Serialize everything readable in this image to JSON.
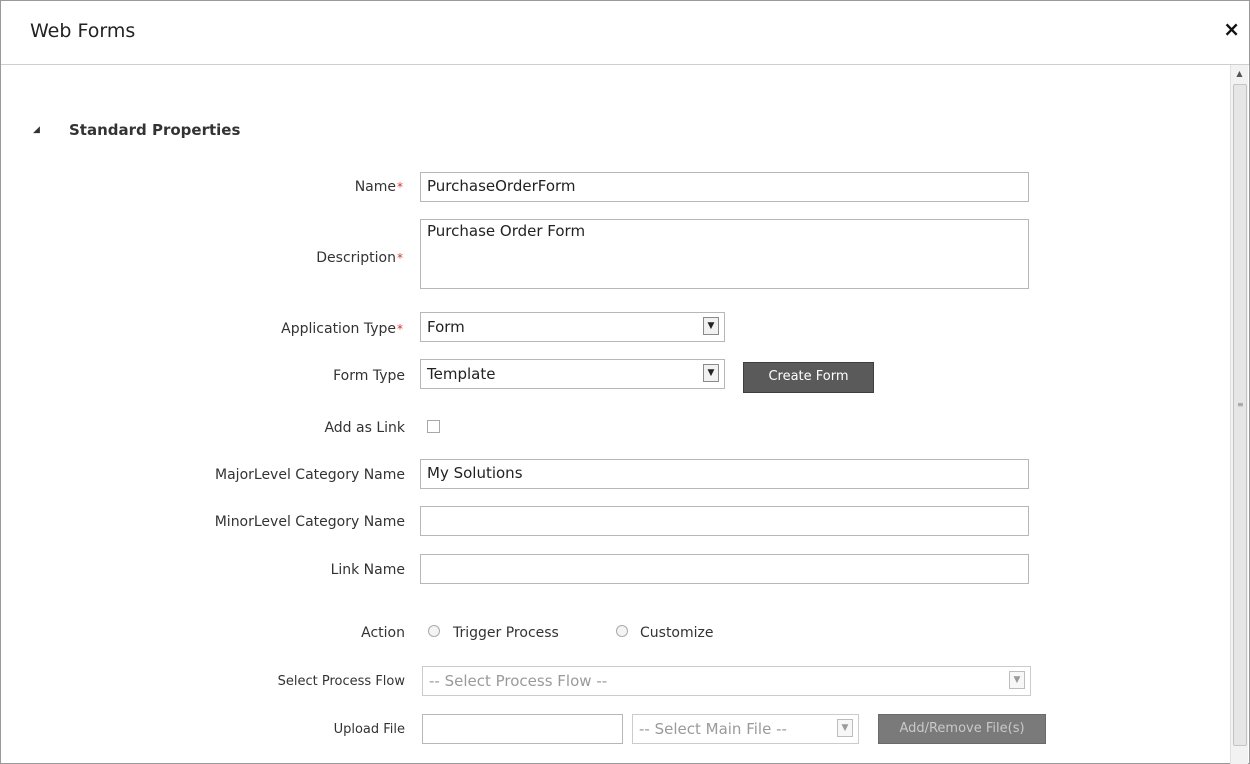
{
  "window": {
    "title": "Web Forms",
    "close_glyph": "×"
  },
  "section": {
    "title": "Standard Properties",
    "icon": "collapse-triangle-icon"
  },
  "fields": {
    "name": {
      "label": "Name",
      "value": "PurchaseOrderForm"
    },
    "description": {
      "label": "Description",
      "value": "Purchase Order Form"
    },
    "application_type": {
      "label": "Application Type",
      "value": "Form"
    },
    "form_type": {
      "label": "Form Type",
      "value": "Template",
      "button": "Create Form"
    },
    "add_as_link": {
      "label": "Add as Link",
      "checked": false
    },
    "major_category": {
      "label": "MajorLevel Category Name",
      "value": "My Solutions"
    },
    "minor_category": {
      "label": "MinorLevel Category Name",
      "value": ""
    },
    "link_name": {
      "label": "Link Name",
      "value": ""
    },
    "action": {
      "label": "Action",
      "options": [
        "Trigger Process",
        "Customize"
      ]
    },
    "process_flow": {
      "label": "Select Process Flow",
      "value": "-- Select Process Flow --"
    },
    "upload_file": {
      "label": "Upload File",
      "value": "",
      "main_file": "-- Select Main File --",
      "button": "Add/Remove File(s)"
    }
  },
  "required_mark": "*",
  "colors": {
    "required": "#d9322b",
    "button_bg": "#5a5a5a"
  }
}
